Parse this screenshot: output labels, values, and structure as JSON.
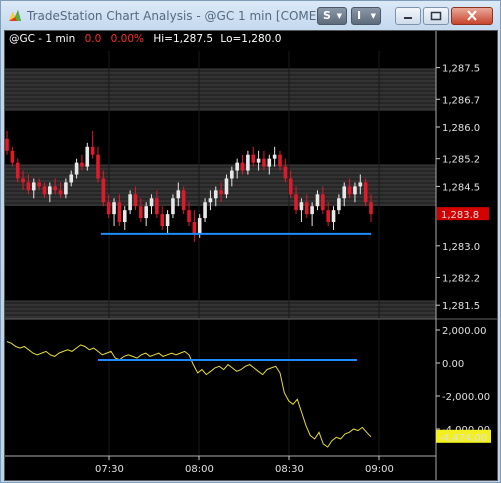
{
  "window": {
    "title": "TradeStation Chart Analysis - @GC 1 min [COME...",
    "menu_s_label": "S",
    "menu_i_label": "I"
  },
  "header": {
    "symbol": "@GC - 1 min",
    "change": "0.0",
    "change_pct": "0.00%",
    "hi": "Hi=1,287.5",
    "lo": "Lo=1,280.0",
    "change_color": "#ff2b2b",
    "hilo_color": "#ffffff"
  },
  "colors": {
    "up_candle": "#e8e8e8",
    "down_candle": "#e0192b",
    "support_line": "#1e8cff",
    "indicator": "#e6dc3c",
    "current_price_bg": "#d40000",
    "current_indicator_bg": "#f2f020",
    "band": "#3a3a3a"
  },
  "icons": {
    "app": "tradestation-logo-icon",
    "minimize": "minimize-icon",
    "maximize": "maximize-icon",
    "close": "close-icon"
  },
  "chart_data": [
    {
      "type": "candlestick",
      "title": "@GC - 1 min",
      "ylim": [
        1280.0,
        1288.0
      ],
      "y_ticks": [
        "1,287.5",
        "1,286.7",
        "1,286.0",
        "1,285.2",
        "1,284.5",
        "1,283.0",
        "1,282.2",
        "1,281.5"
      ],
      "x_ticks": [
        "07:30",
        "08:00",
        "08:30",
        "09:00"
      ],
      "current_price": "1,283.8",
      "support_level": 1283.3,
      "candles": [
        [
          1285.7,
          1285.9,
          1285.3,
          1285.4
        ],
        [
          1285.4,
          1285.5,
          1285.0,
          1285.1
        ],
        [
          1285.1,
          1285.2,
          1284.6,
          1284.7
        ],
        [
          1284.7,
          1284.9,
          1284.4,
          1284.6
        ],
        [
          1284.6,
          1284.8,
          1284.3,
          1284.4
        ],
        [
          1284.4,
          1284.7,
          1284.2,
          1284.6
        ],
        [
          1284.6,
          1284.7,
          1284.4,
          1284.5
        ],
        [
          1284.5,
          1284.6,
          1284.2,
          1284.3
        ],
        [
          1284.3,
          1284.6,
          1284.1,
          1284.5
        ],
        [
          1284.5,
          1284.7,
          1284.3,
          1284.4
        ],
        [
          1284.4,
          1284.6,
          1284.2,
          1284.3
        ],
        [
          1284.3,
          1284.7,
          1284.2,
          1284.6
        ],
        [
          1284.6,
          1284.9,
          1284.5,
          1284.8
        ],
        [
          1284.8,
          1285.2,
          1284.7,
          1285.1
        ],
        [
          1285.1,
          1285.3,
          1284.9,
          1285.0
        ],
        [
          1285.0,
          1285.6,
          1284.9,
          1285.5
        ],
        [
          1285.5,
          1285.9,
          1285.2,
          1285.3
        ],
        [
          1285.3,
          1285.5,
          1284.6,
          1284.7
        ],
        [
          1284.7,
          1284.9,
          1284.0,
          1284.1
        ],
        [
          1284.1,
          1284.3,
          1283.7,
          1283.8
        ],
        [
          1283.8,
          1284.2,
          1283.5,
          1284.1
        ],
        [
          1284.1,
          1284.3,
          1283.5,
          1283.6
        ],
        [
          1283.6,
          1284.0,
          1283.4,
          1283.9
        ],
        [
          1283.9,
          1284.4,
          1283.8,
          1284.3
        ],
        [
          1284.3,
          1284.5,
          1283.9,
          1284.0
        ],
        [
          1284.0,
          1284.2,
          1283.6,
          1283.7
        ],
        [
          1283.7,
          1284.1,
          1283.5,
          1284.0
        ],
        [
          1284.0,
          1284.3,
          1283.8,
          1284.2
        ],
        [
          1284.2,
          1284.4,
          1283.7,
          1283.8
        ],
        [
          1283.8,
          1284.0,
          1283.4,
          1283.5
        ],
        [
          1283.5,
          1283.9,
          1283.3,
          1283.8
        ],
        [
          1283.8,
          1284.3,
          1283.7,
          1284.2
        ],
        [
          1284.2,
          1284.6,
          1284.0,
          1284.4
        ],
        [
          1284.4,
          1284.5,
          1283.8,
          1283.9
        ],
        [
          1283.9,
          1284.1,
          1283.5,
          1283.6
        ],
        [
          1283.6,
          1283.9,
          1283.1,
          1283.3
        ],
        [
          1283.3,
          1283.8,
          1283.2,
          1283.7
        ],
        [
          1283.7,
          1284.2,
          1283.6,
          1284.1
        ],
        [
          1284.1,
          1284.4,
          1283.9,
          1284.2
        ],
        [
          1284.2,
          1284.5,
          1284.0,
          1284.4
        ],
        [
          1284.4,
          1284.6,
          1284.1,
          1284.3
        ],
        [
          1284.3,
          1284.8,
          1284.2,
          1284.7
        ],
        [
          1284.7,
          1285.0,
          1284.5,
          1284.9
        ],
        [
          1284.9,
          1285.2,
          1284.7,
          1285.1
        ],
        [
          1285.1,
          1285.3,
          1284.8,
          1284.9
        ],
        [
          1284.9,
          1285.4,
          1284.8,
          1285.3
        ],
        [
          1285.3,
          1285.5,
          1285.0,
          1285.1
        ],
        [
          1285.1,
          1285.4,
          1284.9,
          1285.2
        ],
        [
          1285.2,
          1285.4,
          1284.9,
          1285.0
        ],
        [
          1285.0,
          1285.3,
          1284.8,
          1285.2
        ],
        [
          1285.2,
          1285.5,
          1285.0,
          1285.3
        ],
        [
          1285.3,
          1285.4,
          1284.9,
          1285.0
        ],
        [
          1285.0,
          1285.2,
          1284.6,
          1284.7
        ],
        [
          1284.7,
          1284.9,
          1284.2,
          1284.3
        ],
        [
          1284.3,
          1284.5,
          1283.8,
          1283.9
        ],
        [
          1283.9,
          1284.2,
          1283.6,
          1284.1
        ],
        [
          1284.1,
          1284.3,
          1283.7,
          1283.8
        ],
        [
          1283.8,
          1284.1,
          1283.5,
          1284.0
        ],
        [
          1284.0,
          1284.4,
          1283.9,
          1284.3
        ],
        [
          1284.3,
          1284.5,
          1283.8,
          1283.9
        ],
        [
          1283.9,
          1284.1,
          1283.5,
          1283.6
        ],
        [
          1283.6,
          1284.0,
          1283.4,
          1283.9
        ],
        [
          1283.9,
          1284.3,
          1283.8,
          1284.2
        ],
        [
          1284.2,
          1284.6,
          1284.0,
          1284.5
        ],
        [
          1284.5,
          1284.7,
          1284.2,
          1284.3
        ],
        [
          1284.3,
          1284.6,
          1284.1,
          1284.5
        ],
        [
          1284.5,
          1284.8,
          1284.3,
          1284.6
        ],
        [
          1284.6,
          1284.7,
          1284.0,
          1284.1
        ],
        [
          1284.1,
          1284.3,
          1283.6,
          1283.8
        ]
      ]
    },
    {
      "type": "line",
      "title": "",
      "ylim": [
        -6000,
        3000
      ],
      "y_ticks": [
        "2,000.00",
        "0.00",
        "-2,000.00",
        "-4,000.00"
      ],
      "x_ticks": [
        "07:30",
        "08:00",
        "08:30",
        "09:00"
      ],
      "current_value": "-4,474.00",
      "zero_reference": 0,
      "values": [
        1300,
        1200,
        1000,
        900,
        1000,
        800,
        600,
        500,
        600,
        700,
        500,
        400,
        600,
        700,
        800,
        700,
        900,
        1100,
        1000,
        800,
        900,
        700,
        500,
        600,
        700,
        300,
        200,
        400,
        500,
        400,
        300,
        500,
        600,
        400,
        500,
        600,
        400,
        500,
        600,
        500,
        600,
        700,
        500,
        -100,
        -600,
        -400,
        -700,
        -500,
        -300,
        -200,
        -400,
        -100,
        -300,
        -500,
        -400,
        -200,
        -100,
        -300,
        -500,
        -700,
        -400,
        -300,
        -200,
        -600,
        -1800,
        -2300,
        -2500,
        -2200,
        -3000,
        -3800,
        -4400,
        -4600,
        -4200,
        -4900,
        -5100,
        -4700,
        -4500,
        -4600,
        -4300,
        -4200,
        -4000,
        -4100,
        -3900,
        -4200,
        -4474
      ]
    }
  ]
}
